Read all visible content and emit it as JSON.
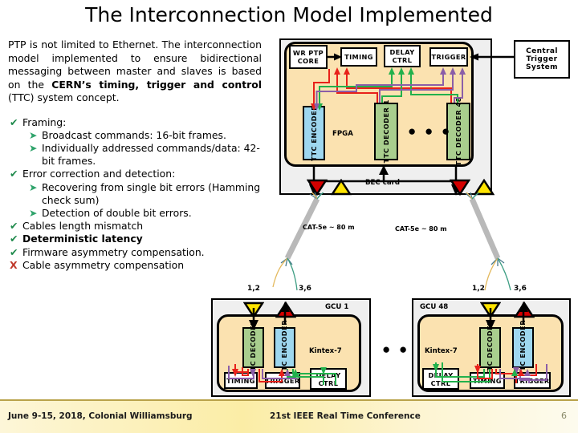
{
  "slide": {
    "title": "The Interconnection Model Implemented",
    "page_number": "6"
  },
  "left_panel": {
    "paragraph_part1": "PTP is not limited to Ethernet. The interconnection model implemented to ensure bidirectional messaging between master and slaves is based on the ",
    "paragraph_bold": "CERN’s timing, trigger and control",
    "paragraph_part2": " (TTC) system concept.",
    "bullets": [
      {
        "marker": "check",
        "text": "Framing:",
        "level": 1,
        "bold": false
      },
      {
        "marker": "arrow",
        "text": "Broadcast commands: 16-bit frames.",
        "level": 2,
        "bold": false
      },
      {
        "marker": "arrow",
        "text": "Individually addressed commands/data: 42-bit frames.",
        "level": 2,
        "bold": false
      },
      {
        "marker": "check",
        "text": "Error correction and detection:",
        "level": 1,
        "bold": false
      },
      {
        "marker": "arrow",
        "text": "Recovering from single bit errors (Hamming check sum)",
        "level": 2,
        "bold": false
      },
      {
        "marker": "arrow",
        "text": "Detection of double bit errors.",
        "level": 2,
        "bold": false
      },
      {
        "marker": "check",
        "text": "Cables length mismatch",
        "level": 1,
        "bold": false
      },
      {
        "marker": "check",
        "text": "Deterministic latency",
        "level": 1,
        "bold": true
      },
      {
        "marker": "check",
        "text": "Firmware asymmetry compensation.",
        "level": 1,
        "bold": false
      },
      {
        "marker": "cross",
        "text": "Cable asymmetry compensation",
        "level": 1,
        "bold": false
      }
    ],
    "markers": {
      "check": "✔",
      "arrow": "➤",
      "cross": "✘"
    }
  },
  "diagram": {
    "bec": {
      "card_label": "BEC card",
      "fpga_label": "FPGA",
      "blocks": {
        "wr_ptp_core": "WR PTP CORE",
        "timing": "TIMING",
        "delay_ctrl": "DELAY CTRL",
        "trigger": "TRIGGER"
      },
      "encoder": "TTC ENCODER",
      "decoder_1": "TTC DECODER 1",
      "decoder_48": "TTC DECODER 48",
      "ellipsis": "● ● ●"
    },
    "central_trigger_system": "Central Trigger System",
    "cables": [
      {
        "label": "CAT-5e ~ 80 m",
        "pair_left": "1,2",
        "pair_right": "3,6"
      },
      {
        "label": "CAT-5e ~ 80 m",
        "pair_left": "1,2",
        "pair_right": "3,6"
      }
    ],
    "gcu1": {
      "name": "GCU 1",
      "fpga_label": "Kintex-7",
      "decoder": "TTC DECODER",
      "encoder": "TTC ENCODER",
      "blocks": {
        "timing": "TIMING",
        "trigger": "TRIGGER",
        "delay_ctrl": "DELAY CTRL"
      }
    },
    "gcu48": {
      "name": "GCU 48",
      "fpga_label": "Kintex-7",
      "decoder": "TTC DECODER",
      "encoder": "TTC ENCODER",
      "blocks": {
        "timing": "TIMING",
        "trigger": "TRIGGER",
        "delay_ctrl": "DELAY CTRL"
      }
    },
    "gcu_ellipsis": "● ● ●",
    "colors": {
      "fpga_fill": "#fbe2b0",
      "card_fill": "#efefef",
      "encoder_fill": "#9ed7ef",
      "decoder_fill": "#a9ce8e",
      "signal_red": "#e8211a",
      "signal_green": "#22b14c",
      "signal_purple": "#8b5ea8",
      "tx_triangle": "#d40000",
      "rx_triangle": "#ffe400"
    }
  },
  "footer": {
    "left": "June 9-15, 2018, Colonial Williamsburg",
    "center": "21st IEEE Real Time Conference"
  }
}
